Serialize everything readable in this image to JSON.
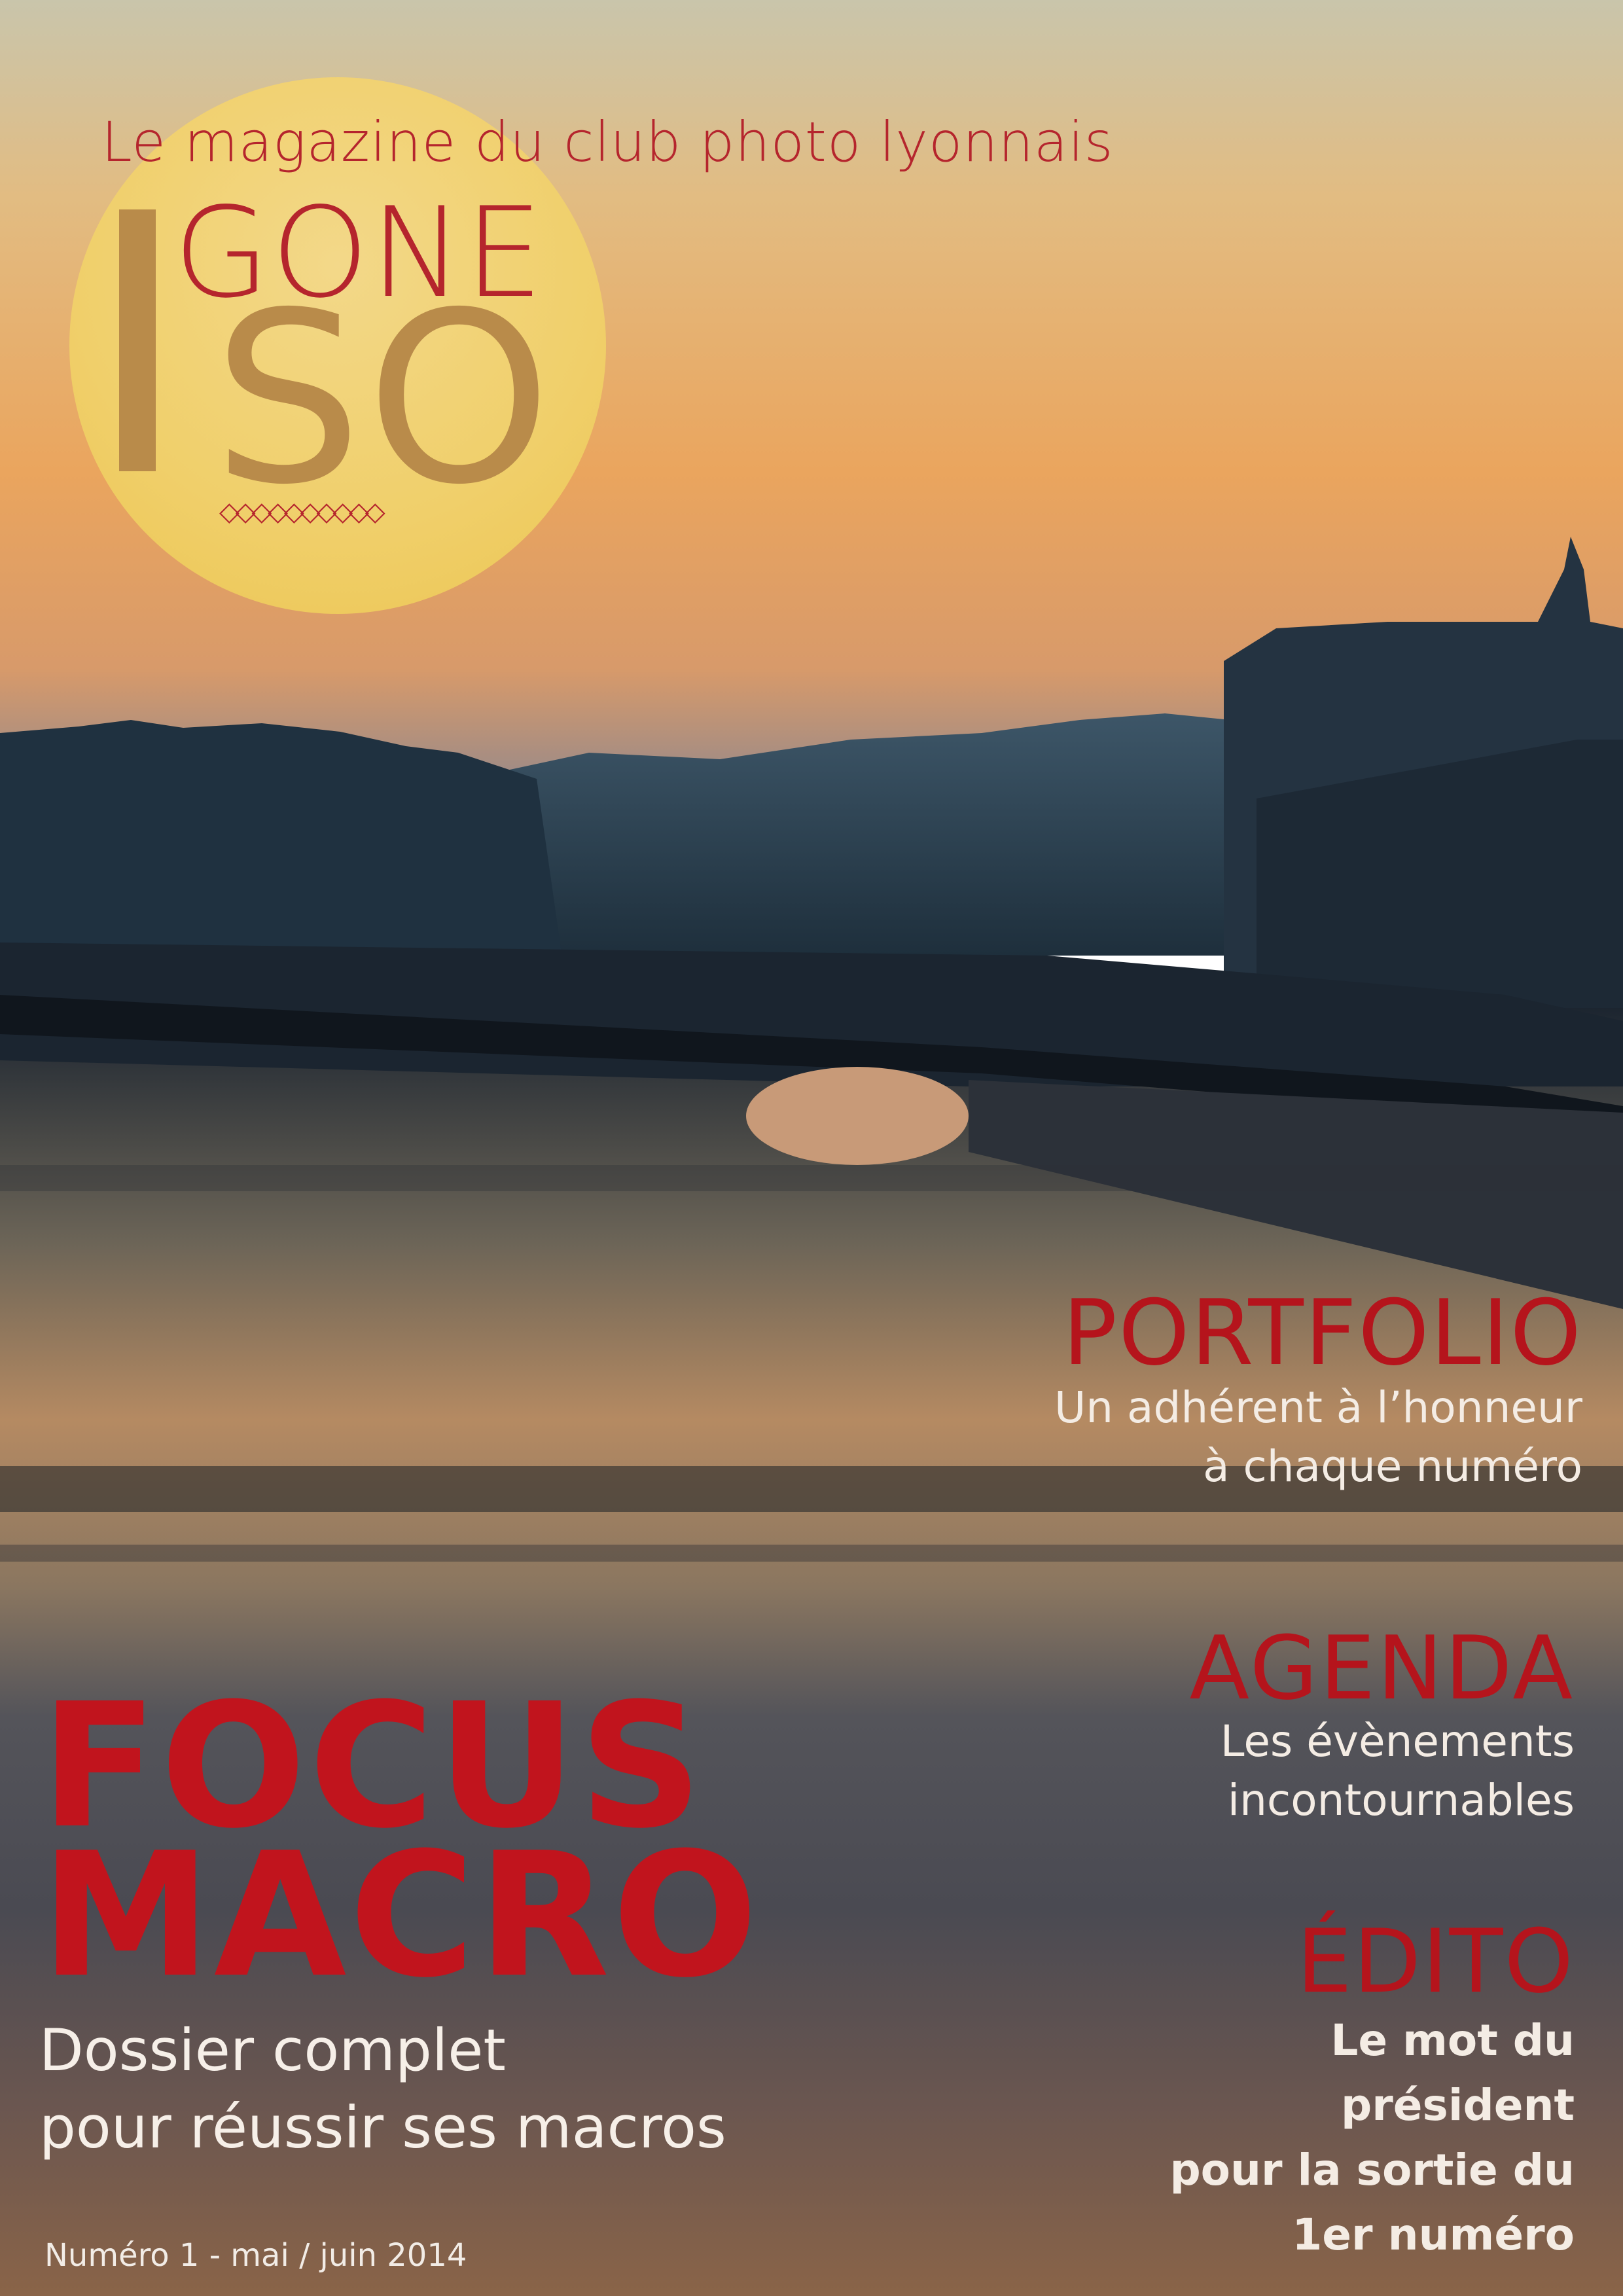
{
  "cover": {
    "tagline": "Le magazine du club photo lyonnais",
    "logo": {
      "top": "GONE",
      "bottom": "SO"
    },
    "teasers": {
      "portfolio": {
        "title": "PORTFOLIO",
        "lines": [
          "Un adhérent à l’honneur",
          "à chaque numéro"
        ]
      },
      "agenda": {
        "title": "AGENDA",
        "lines": [
          "Les évènements",
          "incontournables"
        ]
      },
      "edito": {
        "title": "ÉDITO",
        "lines": [
          "Le mot du",
          "président",
          "pour la sortie du",
          "1er numéro"
        ]
      }
    },
    "feature": {
      "title_lines": [
        "FOCUS",
        "MACRO"
      ],
      "subtitle_lines": [
        "Dossier complet",
        "pour réussir ses macros"
      ]
    },
    "issue": "Numéro 1 - mai / juin 2014"
  },
  "colors": {
    "accent_red": "#b5141c",
    "logo_gold": "#b98b4a",
    "logo_circle": "#f0cf6a"
  }
}
